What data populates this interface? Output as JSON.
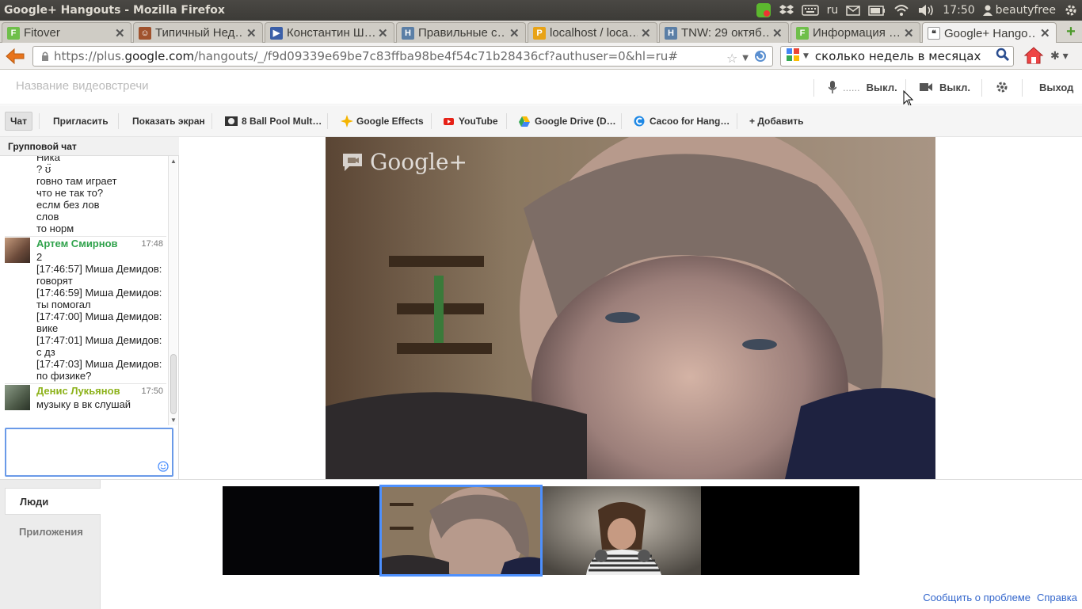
{
  "window": {
    "title": "Google+ Hangouts - Mozilla Firefox"
  },
  "tray": {
    "lang": "ru",
    "clock": "17:50",
    "user": "beautyfree"
  },
  "tabs": [
    {
      "label": "Fitover",
      "favicon_color": "#6fbf4a",
      "favicon_char": "F"
    },
    {
      "label": "Типичный Нед…",
      "favicon_color": "#a0522d",
      "favicon_char": "☺"
    },
    {
      "label": "Константин Ш…",
      "favicon_color": "#3b5fa8",
      "favicon_char": "▶"
    },
    {
      "label": "Правильные с…",
      "favicon_color": "#5b7fa6",
      "favicon_char": "H"
    },
    {
      "label": "localhost / loca…",
      "favicon_color": "#e8a317",
      "favicon_char": "P"
    },
    {
      "label": "TNW: 29 октяб…",
      "favicon_color": "#5b7fa6",
      "favicon_char": "H"
    },
    {
      "label": "Информация …",
      "favicon_color": "#6fbf4a",
      "favicon_char": "F"
    },
    {
      "label": "Google+ Hango…",
      "favicon_color": "#4a4a4a",
      "favicon_char": "❝"
    }
  ],
  "nav": {
    "url_prefix": "https://plus.",
    "url_host": "google.com",
    "url_rest": "/hangouts/_/f9d09339e69be7c83ffba98be4f54c71b28436cf?authuser=0&hl=ru#",
    "search_value": "сколько недель в месяцах"
  },
  "hangout": {
    "name_placeholder": "Название видеовстречи",
    "mic_label": "Выкл.",
    "mic_level": "......",
    "cam_label": "Выкл.",
    "exit_label": "Выход"
  },
  "toolbar": {
    "chat": "Чат",
    "invite": "Пригласить",
    "screen": "Показать экран",
    "app1": "8 Ball Pool Mult…",
    "app2": "Google Effects",
    "app3": "YouTube",
    "app4": "Google Drive (D…",
    "app5": "Cacoo for Hang…",
    "add": "+ Добавить"
  },
  "chat": {
    "title": "Групповой чат",
    "block0_lines": [
      "Ника",
      "? ʊ̈",
      "говно там играет",
      "что не так то?",
      "еслм без лов",
      "слов",
      "то норм"
    ],
    "msg1": {
      "author": "Артем Смирнов",
      "author_color": "#2fa24b",
      "time": "17:48",
      "lines": [
        "2",
        "[17:46:57] Миша Демидов:",
        "говорят",
        "[17:46:59] Миша Демидов:",
        "ты помогал",
        "[17:47:00] Миша Демидов:",
        "вике",
        "[17:47:01] Миша Демидов:",
        "с дз",
        "[17:47:03] Миша Демидов:",
        "по физике?"
      ]
    },
    "msg2": {
      "author": "Денис Лукьянов",
      "author_color": "#8db21b",
      "time": "17:50",
      "lines": [
        "музыку в вк слушай"
      ]
    }
  },
  "video": {
    "watermark": "Google+"
  },
  "bottom": {
    "people_tab": "Люди",
    "apps_tab": "Приложения"
  },
  "footer": {
    "report": "Сообщить о проблеме",
    "help": "Справка"
  }
}
